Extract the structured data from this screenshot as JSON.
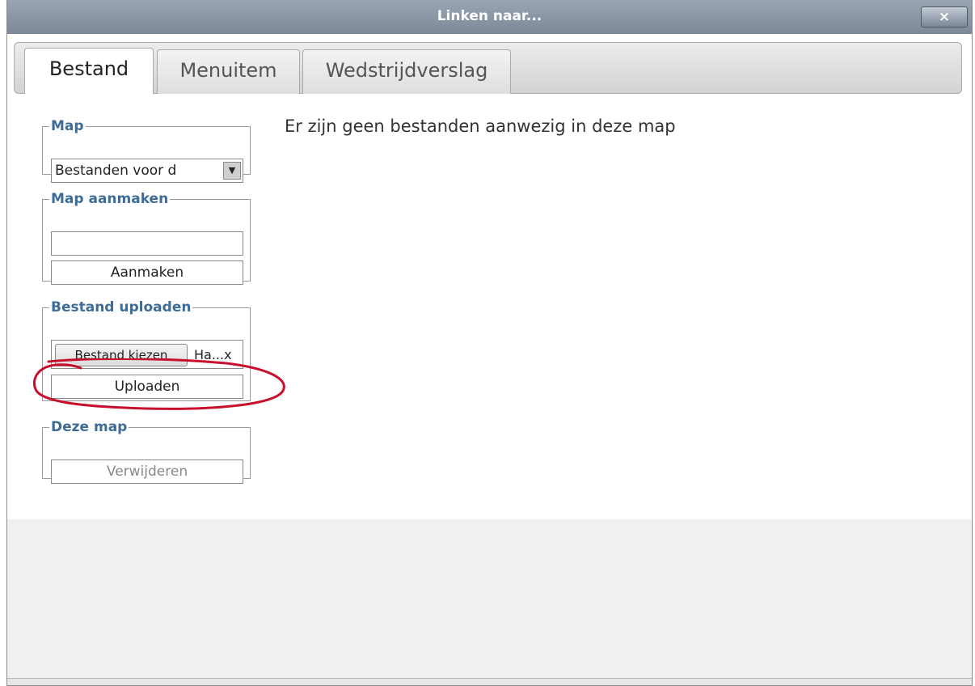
{
  "window": {
    "title": "Linken naar...",
    "close_label": "×"
  },
  "tabs": [
    {
      "label": "Bestand",
      "active": true
    },
    {
      "label": "Menuitem",
      "active": false
    },
    {
      "label": "Wedstrijdverslag",
      "active": false
    }
  ],
  "folder_group": {
    "legend": "Map",
    "selected": "Bestanden voor d"
  },
  "create_folder": {
    "legend": "Map aanmaken",
    "input_value": "",
    "button_label": "Aanmaken"
  },
  "upload": {
    "legend": "Bestand uploaden",
    "choose_label": "Bestand kiezen",
    "file_name": "Ha...x",
    "button_label": "Uploaden"
  },
  "current_folder": {
    "legend": "Deze map",
    "delete_label": "Verwijderen"
  },
  "message": "Er zijn geen bestanden aanwezig in deze map",
  "annotation_color": "#c8102e"
}
